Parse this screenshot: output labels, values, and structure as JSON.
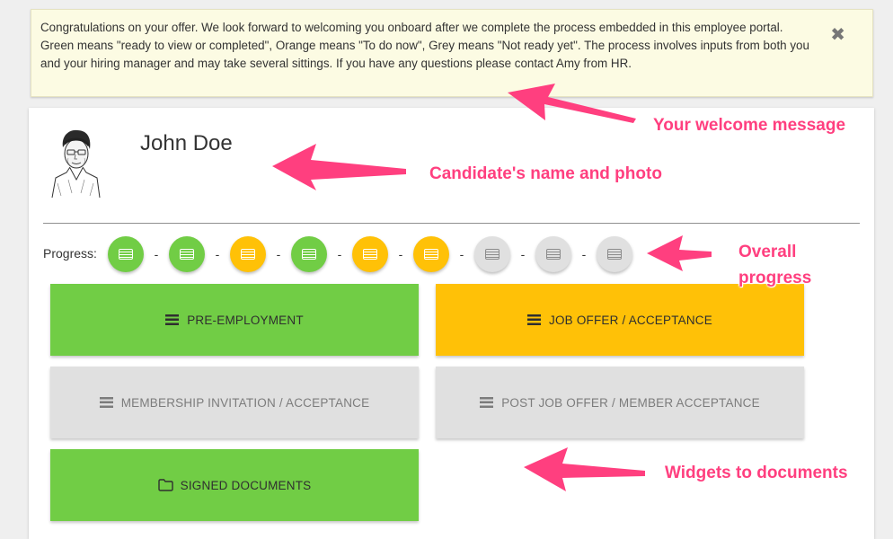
{
  "alert": {
    "message": "Congratulations on your offer. We look forward to welcoming you onboard after we complete the process embedded in this employee portal. Green means \"ready to view or completed\", Orange means \"To do now\", Grey means \"Not ready yet\". The process involves inputs from both you and your hiring manager and may take several sittings. If you have any questions please contact Amy from HR.",
    "close_glyph": "✖"
  },
  "candidate": {
    "name": "John Doe",
    "photo": "candidate-sketch-portrait"
  },
  "progress": {
    "label": "Progress:",
    "separator": "-",
    "steps": [
      "green",
      "green",
      "orange",
      "green",
      "orange",
      "orange",
      "grey",
      "grey",
      "grey"
    ]
  },
  "widgets": {
    "pre_employment": "PRE-EMPLOYMENT",
    "job_offer": "JOB OFFER / ACCEPTANCE",
    "membership": "MEMBERSHIP INVITATION / ACCEPTANCE",
    "post_job_offer": "POST JOB OFFER / MEMBER ACCEPTANCE",
    "signed_documents": "SIGNED DOCUMENTS"
  },
  "annotations": {
    "welcome": "Your welcome message",
    "candidate": "Candidate's name and photo",
    "overall_progress": "Overall progress",
    "widgets": "Widgets to documents"
  },
  "colors": {
    "green": "#71cd45",
    "orange": "#ffc107",
    "grey": "#e0e0e0",
    "annotation": "#ff3f7f",
    "alert_bg": "#fcfbe3"
  }
}
